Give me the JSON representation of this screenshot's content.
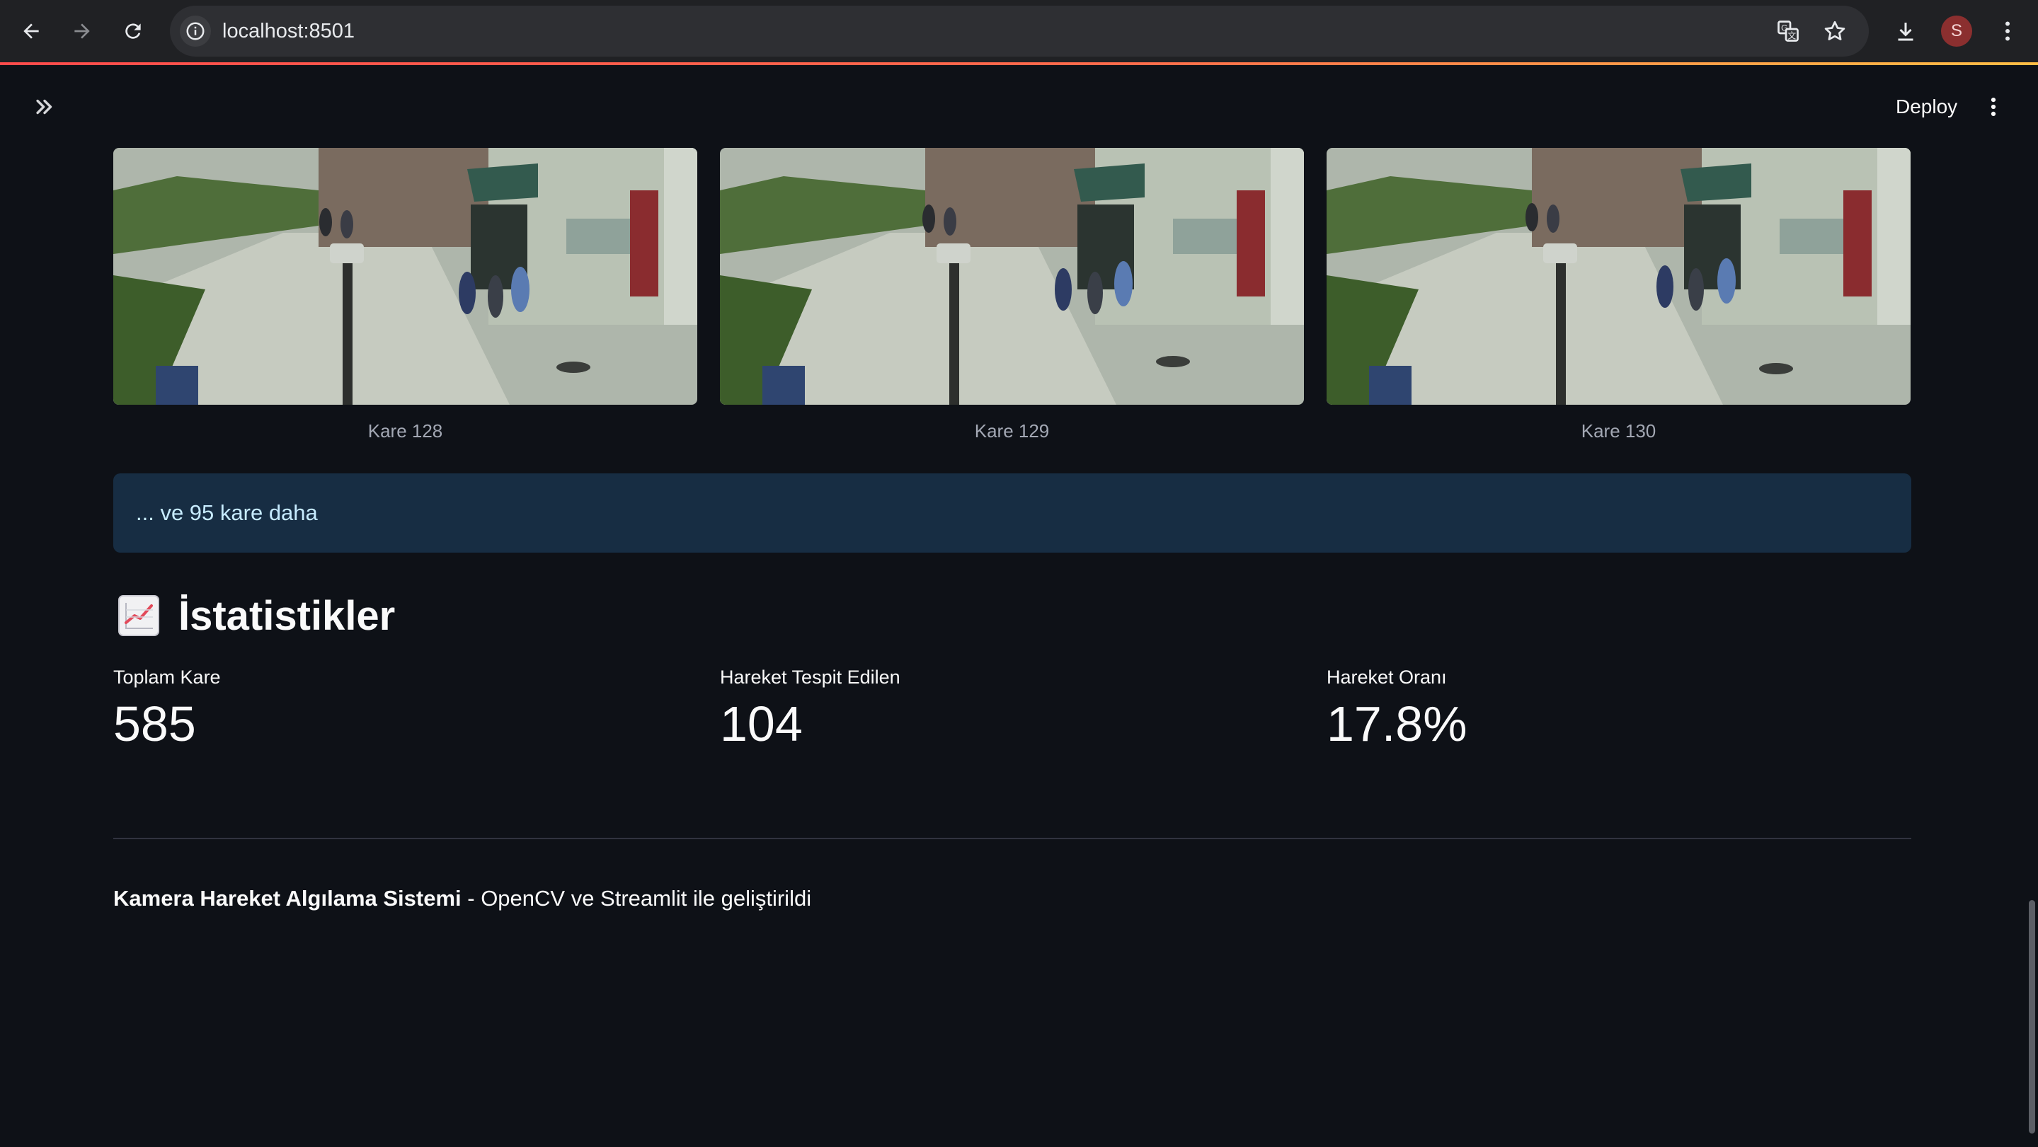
{
  "browser": {
    "url": "localhost:8501",
    "avatar_letter": "S",
    "icons": [
      "back-arrow-icon",
      "forward-arrow-icon",
      "reload-icon",
      "site-info-icon",
      "translate-icon",
      "bookmark-star-icon",
      "download-icon",
      "browser-menu-icon"
    ]
  },
  "header": {
    "deploy_label": "Deploy"
  },
  "frames": [
    {
      "caption": "Kare 128"
    },
    {
      "caption": "Kare 129"
    },
    {
      "caption": "Kare 130"
    }
  ],
  "info": {
    "text": "... ve 95 kare daha"
  },
  "stats": {
    "title": "İstatistikler",
    "metrics": [
      {
        "label": "Toplam Kare",
        "value": "585"
      },
      {
        "label": "Hareket Tespit Edilen",
        "value": "104"
      },
      {
        "label": "Hareket Oranı",
        "value": "17.8%"
      }
    ]
  },
  "footer": {
    "bold": "Kamera Hareket Algılama Sistemi",
    "rest": " - OpenCV ve Streamlit ile geliştirildi"
  },
  "colors": {
    "background": "#0e1117",
    "info_bg": "#172d43",
    "info_text": "#c7ebff",
    "accent": "#ff4b4b"
  }
}
